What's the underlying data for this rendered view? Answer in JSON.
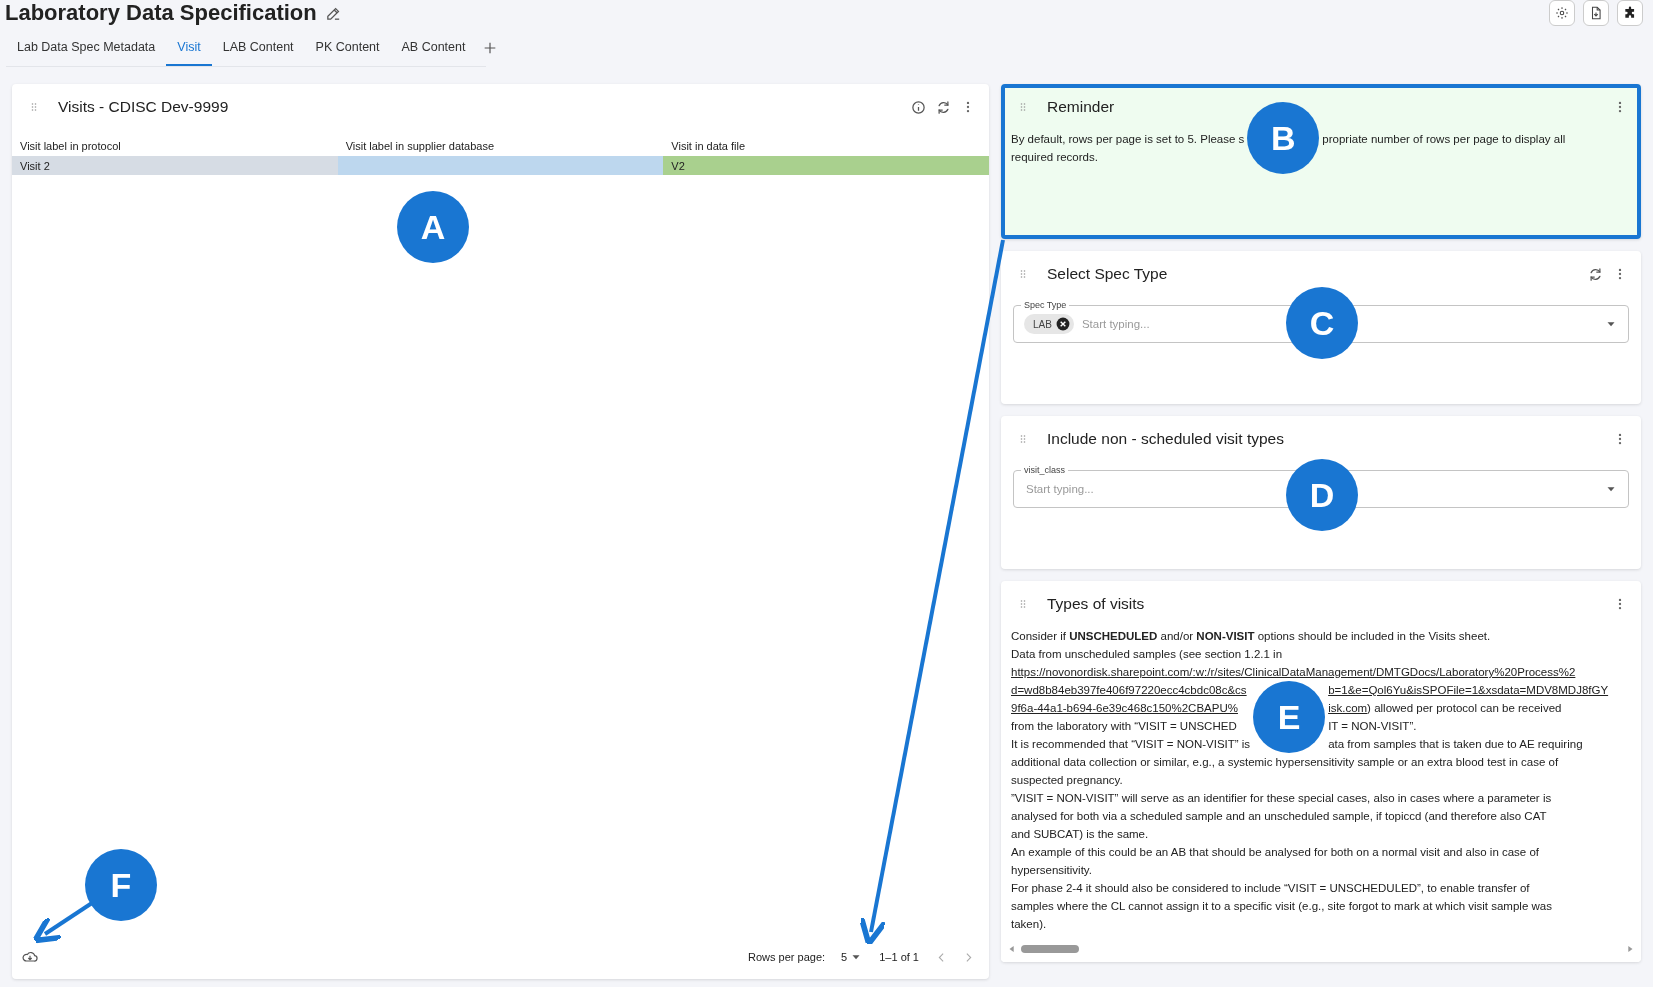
{
  "page": {
    "title": "Laboratory Data Specification"
  },
  "tabs": [
    {
      "label": "Lab Data Spec Metadata",
      "selected": false
    },
    {
      "label": "Visit",
      "selected": true
    },
    {
      "label": "LAB Content",
      "selected": false
    },
    {
      "label": "PK Content",
      "selected": false
    },
    {
      "label": "AB Content",
      "selected": false
    }
  ],
  "visits_panel": {
    "title": "Visits - CDISC Dev-9999",
    "callout": "A",
    "columns": [
      "Visit label in protocol",
      "Visit label in supplier database",
      "Visit in data file"
    ],
    "rows": [
      {
        "cells": [
          {
            "text": "Visit 2",
            "color": "#d6dce4"
          },
          {
            "color": "#bdd7ee"
          },
          {
            "text": "V2",
            "color": "#a9d08e"
          }
        ]
      }
    ],
    "footer": {
      "callout": "F",
      "rows_per_page_label": "Rows per page:",
      "rows_per_page": "5",
      "range": "1–1 of 1"
    }
  },
  "reminder": {
    "title": "Reminder",
    "callout": "B",
    "highlighted": true,
    "lines": [
      {
        "segments": [
          {
            "kind": "text",
            "text": "By default, rows per page is set to 5. Please s"
          },
          {
            "kind": "gap"
          },
          {
            "kind": "text",
            "text": "propriate number of rows per page to display all"
          }
        ]
      },
      {
        "segments": [
          {
            "kind": "text",
            "text": "required records."
          }
        ]
      }
    ]
  },
  "spec_type": {
    "title": "Select Spec Type",
    "callout": "C",
    "field": {
      "label": "Spec Type",
      "chips": [
        "LAB"
      ],
      "placeholder": "Start typing..."
    }
  },
  "visit_class": {
    "title": "Include non - scheduled visit types",
    "callout": "D",
    "field": {
      "label": "visit_class",
      "placeholder": "Start typing..."
    }
  },
  "types_of_visits": {
    "title": "Types of visits",
    "callout": "E",
    "lines": [
      {
        "segments": [
          {
            "kind": "text",
            "text": "Consider if **UNSCHEDULED** and/or **NON-VISIT** options should be included in the Visits sheet."
          }
        ]
      },
      {
        "segments": [
          {
            "kind": "text",
            "text": "Data from unscheduled samples (see section 1.2.1 in"
          }
        ]
      },
      {
        "segments": [
          {
            "kind": "link",
            "text": "https://novonordisk.sharepoint.com/:w:/r/sites/ClinicalDataManagement/DMTGDocs/Laboratory%20Process%2"
          }
        ]
      },
      {
        "segments": [
          {
            "kind": "link",
            "text": "d=wd8b84eb397fe406f97220ecc4cbdc08c&cs"
          },
          {
            "kind": "gap"
          },
          {
            "kind": "link",
            "text": "b=1&e=Qol6Yu&isSPOFile=1&xsdata=MDV8MDJ8fGY"
          }
        ]
      },
      {
        "segments": [
          {
            "kind": "link",
            "text": "9f6a-44a1-b694-6e39c468c150%2CBAPU%"
          },
          {
            "kind": "gap"
          },
          {
            "kind": "link",
            "text": "isk.com"
          },
          {
            "kind": "text",
            "text": ") allowed per protocol can be received"
          }
        ]
      },
      {
        "segments": [
          {
            "kind": "text",
            "text": "from the laboratory with “VISIT = UNSCHED"
          },
          {
            "kind": "gap"
          },
          {
            "kind": "text",
            "text": "IT = NON-VISIT”."
          }
        ]
      },
      {
        "segments": [
          {
            "kind": "text",
            "text": "It is recommended that “VISIT = NON-VISIT” is"
          },
          {
            "kind": "gap"
          },
          {
            "kind": "text",
            "text": "ata from samples that is taken due to AE requiring"
          }
        ]
      },
      {
        "segments": [
          {
            "kind": "text",
            "text": "additional data collection or similar, e.g., a systemic hypersensitivity sample or an extra blood test in case of"
          }
        ]
      },
      {
        "segments": [
          {
            "kind": "text",
            "text": "suspected pregnancy."
          }
        ]
      },
      {
        "segments": [
          {
            "kind": "text",
            "text": "”VISIT = NON-VISIT” will serve as an identifier for these special cases, also in cases where a parameter is"
          }
        ]
      },
      {
        "segments": [
          {
            "kind": "text",
            "text": "analysed for both via a scheduled sample and an unscheduled sample, if topiccd (and therefore also CAT"
          }
        ]
      },
      {
        "segments": [
          {
            "kind": "text",
            "text": "and SUBCAT) is the same."
          }
        ]
      },
      {
        "segments": [
          {
            "kind": "text",
            "text": "An example of this could be an AB that should be analysed for both on a normal visit and also in case of"
          }
        ]
      },
      {
        "segments": [
          {
            "kind": "text",
            "text": "hypersensitivity."
          }
        ]
      },
      {
        "segments": [
          {
            "kind": "text",
            "text": "For phase 2-4 it should also be considered to include “VISIT = UNSCHEDULED”, to enable transfer of"
          }
        ]
      },
      {
        "segments": [
          {
            "kind": "text",
            "text": "samples where the CL cannot assign it to a specific visit (e.g., site forgot to mark at which visit sample was"
          }
        ]
      },
      {
        "segments": [
          {
            "kind": "text",
            "text": "taken)."
          }
        ]
      }
    ]
  }
}
